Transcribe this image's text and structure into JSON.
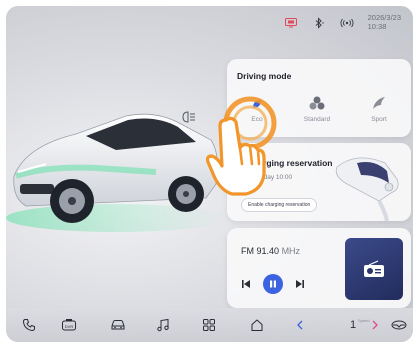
{
  "status": {
    "date": "2026/3/23",
    "time": "10:38",
    "icons": [
      "display-icon",
      "bluetooth-icon",
      "signal-icon"
    ]
  },
  "driving_mode": {
    "title": "Driving mode",
    "modes": [
      {
        "label": "Eco",
        "icon": "eco-leaf-icon",
        "selected": true
      },
      {
        "label": "Standard",
        "icon": "standard-icon",
        "selected": false
      },
      {
        "label": "Sport",
        "icon": "sport-icon",
        "selected": false
      }
    ]
  },
  "charging": {
    "title": "Charging reservation",
    "schedule": "Everyday 10:00",
    "button_label": "Enable charging reservation"
  },
  "radio": {
    "prefix": "FM",
    "frequency": "91.40",
    "unit": "MHz"
  },
  "dock": {
    "speed_value": "1",
    "speed_label": "Speed",
    "items": [
      "phone-icon",
      "dvr-icon",
      "car-icon",
      "music-icon",
      "apps-icon",
      "home-icon",
      "back-icon",
      "forward-icon",
      "steering-icon"
    ]
  },
  "colors": {
    "accent": "#3b63e0",
    "highlight": "#f2952a",
    "car_glow": "#55e0a0"
  }
}
